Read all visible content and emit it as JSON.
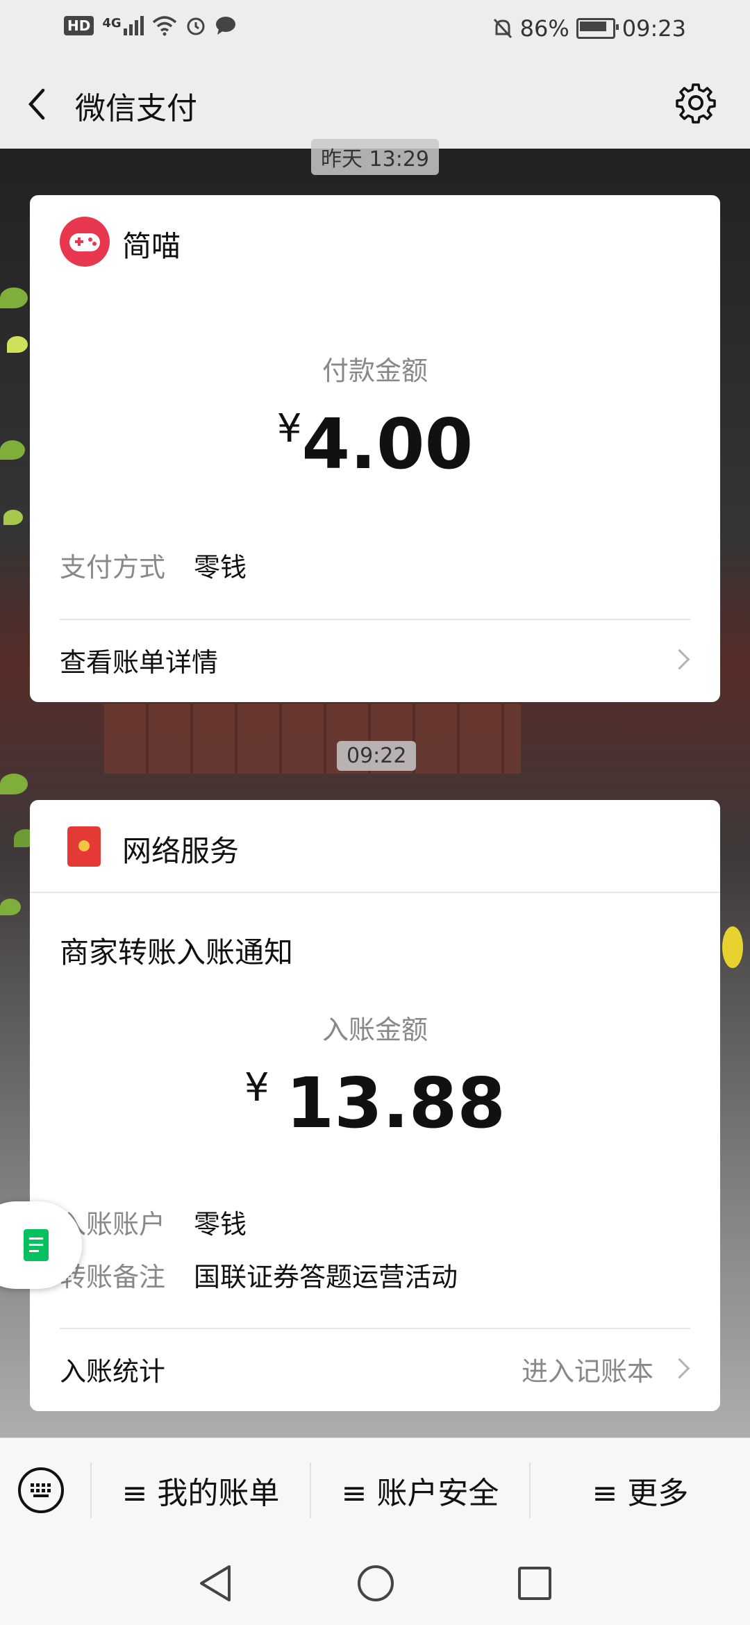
{
  "status_bar": {
    "left_icons": [
      "hd-icon",
      "4g-signal-icon",
      "wifi-icon",
      "alarm-icon",
      "message-icon"
    ],
    "hd_label": "HD",
    "network_label": "4G",
    "battery_percent": "86%",
    "time": "09:23"
  },
  "header": {
    "title": "微信支付"
  },
  "messages": [
    {
      "timestamp": "昨天 13:29",
      "merchant": "简喵",
      "amount_label": "付款金额",
      "currency": "¥",
      "amount": "4.00",
      "method_label": "支付方式",
      "method_value": "零钱",
      "detail_link": "查看账单详情"
    },
    {
      "timestamp": "09:22",
      "merchant": "网络服务",
      "notice_title": "商家转账入账通知",
      "amount_label": "入账金额",
      "currency": "¥",
      "amount": "13.88",
      "account_label": "入账账户",
      "account_value": "零钱",
      "remark_label": "转账备注",
      "remark_value": "国联证券答题运营活动",
      "stats_label": "入账统计",
      "stats_link": "进入记账本"
    }
  ],
  "bottom_menu": {
    "items": [
      "≡ 我的账单",
      "≡ 账户安全",
      "≡ 更多"
    ]
  },
  "colors": {
    "accent_green": "#07c160",
    "red_packet": "#e53935",
    "avatar_pink": "#e8384f"
  }
}
